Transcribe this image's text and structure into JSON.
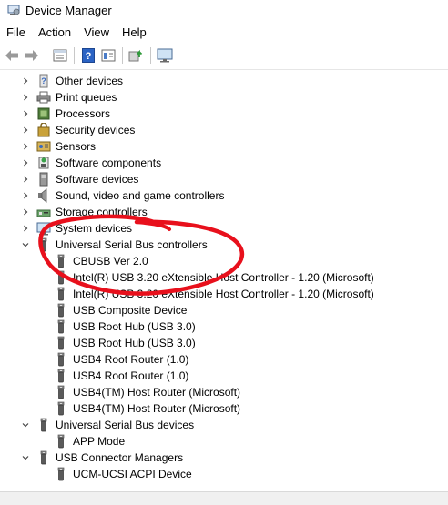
{
  "window": {
    "title": "Device Manager"
  },
  "menu": [
    "File",
    "Action",
    "View",
    "Help"
  ],
  "toolbar": [
    "back-icon",
    "forward-icon",
    "properties-icon",
    "help-icon",
    "view-icon",
    "update-driver-icon",
    "monitor-icon"
  ],
  "tree": [
    {
      "label": "Other devices",
      "level": 0,
      "expanded": false,
      "icon": "other-devices-icon"
    },
    {
      "label": "Print queues",
      "level": 0,
      "expanded": false,
      "icon": "printer-icon"
    },
    {
      "label": "Processors",
      "level": 0,
      "expanded": false,
      "icon": "processor-icon"
    },
    {
      "label": "Security devices",
      "level": 0,
      "expanded": false,
      "icon": "security-device-icon"
    },
    {
      "label": "Sensors",
      "level": 0,
      "expanded": false,
      "icon": "sensor-icon"
    },
    {
      "label": "Software components",
      "level": 0,
      "expanded": false,
      "icon": "software-component-icon"
    },
    {
      "label": "Software devices",
      "level": 0,
      "expanded": false,
      "icon": "software-device-icon"
    },
    {
      "label": "Sound, video and game controllers",
      "level": 0,
      "expanded": false,
      "icon": "speaker-icon"
    },
    {
      "label": "Storage controllers",
      "level": 0,
      "expanded": false,
      "icon": "storage-controller-icon"
    },
    {
      "label": "System devices",
      "level": 0,
      "expanded": false,
      "icon": "system-device-icon"
    },
    {
      "label": "Universal Serial Bus controllers",
      "level": 0,
      "expanded": true,
      "icon": "usb-icon"
    },
    {
      "label": "CBUSB Ver 2.0",
      "level": 1,
      "icon": "usb-icon"
    },
    {
      "label": "Intel(R) USB 3.20 eXtensible Host Controller - 1.20 (Microsoft)",
      "level": 1,
      "icon": "usb-icon"
    },
    {
      "label": "Intel(R) USB 3.20 eXtensible Host Controller - 1.20 (Microsoft)",
      "level": 1,
      "icon": "usb-icon"
    },
    {
      "label": "USB Composite Device",
      "level": 1,
      "icon": "usb-icon"
    },
    {
      "label": "USB Root Hub (USB 3.0)",
      "level": 1,
      "icon": "usb-icon"
    },
    {
      "label": "USB Root Hub (USB 3.0)",
      "level": 1,
      "icon": "usb-icon"
    },
    {
      "label": "USB4 Root Router (1.0)",
      "level": 1,
      "icon": "usb-icon"
    },
    {
      "label": "USB4 Root Router (1.0)",
      "level": 1,
      "icon": "usb-icon"
    },
    {
      "label": "USB4(TM) Host Router (Microsoft)",
      "level": 1,
      "icon": "usb-icon"
    },
    {
      "label": "USB4(TM) Host Router (Microsoft)",
      "level": 1,
      "icon": "usb-icon"
    },
    {
      "label": "Universal Serial Bus devices",
      "level": 0,
      "expanded": true,
      "icon": "usb-icon"
    },
    {
      "label": "APP Mode",
      "level": 1,
      "icon": "usb-icon"
    },
    {
      "label": "USB Connector Managers",
      "level": 0,
      "expanded": true,
      "icon": "usb-icon"
    },
    {
      "label": "UCM-UCSI ACPI Device",
      "level": 1,
      "icon": "usb-icon"
    }
  ],
  "colors": {
    "annotation_red": "#e8101c",
    "toolbar_blue": "#2b63c4"
  }
}
